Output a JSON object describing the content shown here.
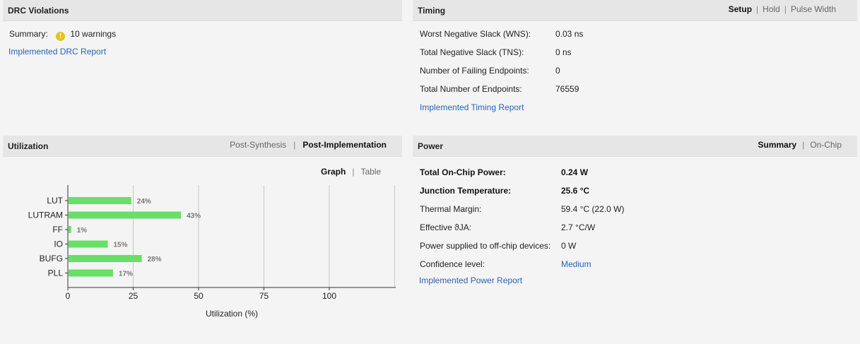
{
  "drc": {
    "title": "DRC Violations",
    "summary_label": "Summary:",
    "warning_icon": "warning-icon",
    "summary_value": "10 warnings",
    "report_link": "Implemented DRC Report"
  },
  "timing": {
    "title": "Timing",
    "tabs": [
      "Setup",
      "Hold",
      "Pulse Width"
    ],
    "active_tab": "Setup",
    "rows": [
      {
        "label": "Worst Negative Slack (WNS):",
        "value": "0.03 ns"
      },
      {
        "label": "Total Negative Slack (TNS):",
        "value": "0 ns"
      },
      {
        "label": "Number of Failing Endpoints:",
        "value": "0"
      },
      {
        "label": "Total Number of Endpoints:",
        "value": "76559"
      }
    ],
    "report_link": "Implemented Timing Report"
  },
  "utilization": {
    "title": "Utilization",
    "tabs": [
      "Post-Synthesis",
      "Post-Implementation"
    ],
    "active_tab": "Post-Implementation",
    "view_tabs": [
      "Graph",
      "Table"
    ],
    "active_view": "Graph"
  },
  "power": {
    "title": "Power",
    "tabs": [
      "Summary",
      "On-Chip"
    ],
    "active_tab": "Summary",
    "rows": [
      {
        "label": "Total On-Chip Power:",
        "value": "0.24 W"
      },
      {
        "label": "Junction Temperature:",
        "value": "25.6 °C"
      },
      {
        "label": "Thermal Margin:",
        "value": "59.4 °C (22.0 W)"
      },
      {
        "label": "Effective ϑJA:",
        "value": "2.7 °C/W"
      },
      {
        "label": "Power supplied to off-chip devices:",
        "value": "0 W"
      },
      {
        "label": "Confidence level:",
        "value": "Medium"
      }
    ],
    "report_link": "Implemented Power Report"
  },
  "chart_data": {
    "type": "bar",
    "orientation": "horizontal",
    "categories": [
      "LUT",
      "LUTRAM",
      "FF",
      "IO",
      "BUFG",
      "PLL"
    ],
    "values": [
      24,
      43,
      1,
      15,
      28,
      17
    ],
    "value_labels": [
      "24%",
      "43%",
      "1%",
      "15%",
      "28%",
      "17%"
    ],
    "xlabel": "Utilization (%)",
    "xticks": [
      0,
      25,
      50,
      75,
      100
    ],
    "xlim": [
      0,
      125
    ],
    "grid": true,
    "bar_color": "#66e066"
  }
}
